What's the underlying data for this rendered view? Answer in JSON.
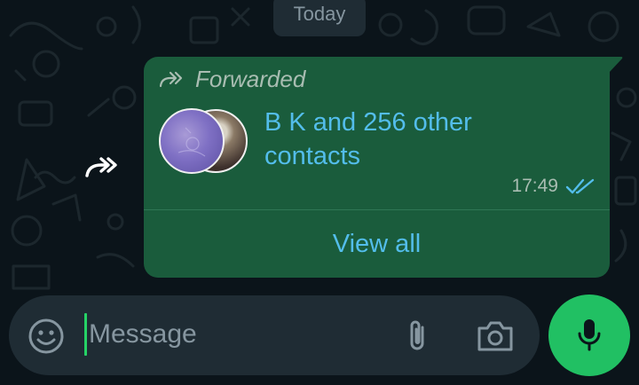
{
  "date_chip": {
    "label": "Today"
  },
  "message": {
    "forwarded_label": "Forwarded",
    "contacts_text": "B K and 256 other contacts",
    "time": "17:49",
    "status_icon": "double-check-icon",
    "action_label": "View all"
  },
  "composer": {
    "placeholder": "Message",
    "value": "",
    "emoji_icon": "smiley-icon",
    "attach_icon": "paperclip-icon",
    "camera_icon": "camera-icon",
    "send_icon": "microphone-icon"
  },
  "colors": {
    "background": "#0b141a",
    "bubble_outgoing": "#1a5c3c",
    "link_blue": "#53bdeb",
    "accent_green": "#21c063",
    "input_bg": "#1f2c34",
    "muted_text": "#8696a0"
  }
}
